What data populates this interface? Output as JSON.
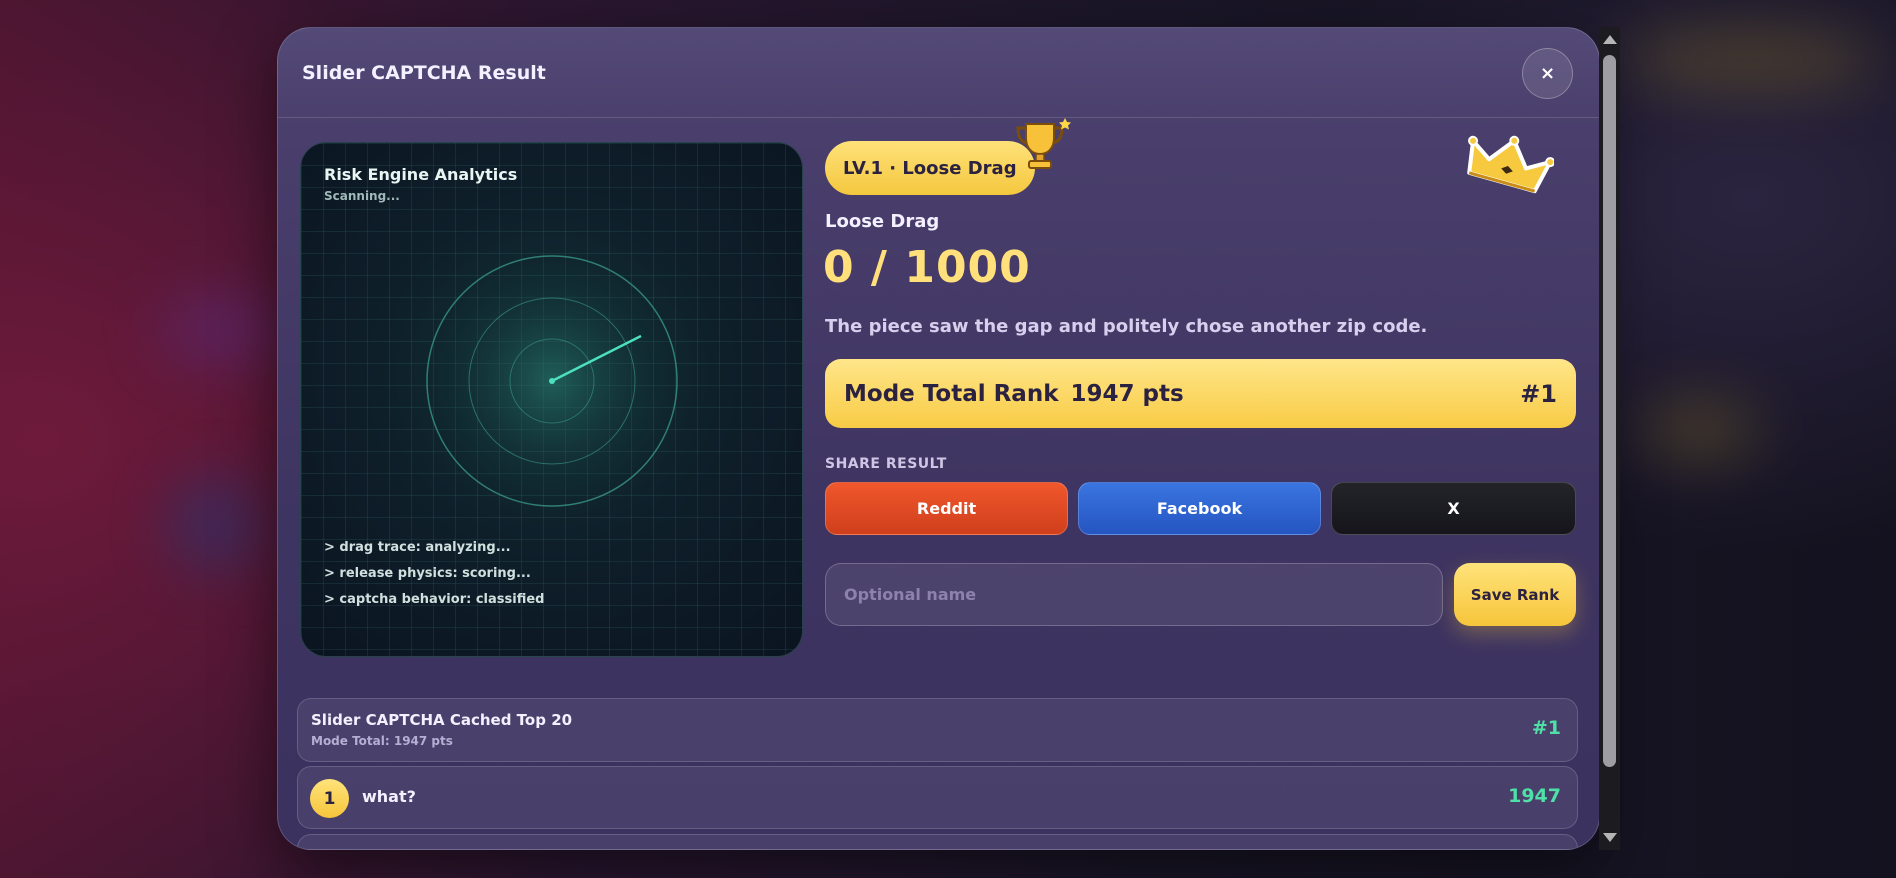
{
  "modal": {
    "title": "Slider CAPTCHA Result",
    "close_label": "×"
  },
  "analytics": {
    "title": "Risk Engine Analytics",
    "status": "Scanning...",
    "log": [
      "> drag trace: analyzing...",
      "> release physics: scoring...",
      "> captcha behavior: classified"
    ]
  },
  "result": {
    "level_badge": "LV.1 · Loose Drag",
    "mode_label": "Loose Drag",
    "score": "0 / 1000",
    "quip": "The piece saw the gap and politely chose another zip code.",
    "rank_label": "Mode Total Rank",
    "rank_points": "1947 pts",
    "rank_position": "#1"
  },
  "share": {
    "label": "SHARE RESULT",
    "reddit": "Reddit",
    "facebook": "Facebook",
    "x": "X"
  },
  "save": {
    "placeholder": "Optional name",
    "button": "Save Rank"
  },
  "leaderboard": {
    "title": "Slider CAPTCHA Cached Top 20",
    "subtitle": "Mode Total: 1947 pts",
    "my_rank": "#1",
    "rows": [
      {
        "rank": "1",
        "name": "what?",
        "score": "1947"
      }
    ]
  },
  "colors": {
    "accent_yellow": "#f8cb45",
    "score_green": "#4ee0a6",
    "reddit": "#e04b24",
    "facebook": "#2f66d4",
    "x": "#1b1b22"
  },
  "icons": [
    "close-icon",
    "trophy-icon",
    "crown-icon",
    "radar-icon"
  ]
}
